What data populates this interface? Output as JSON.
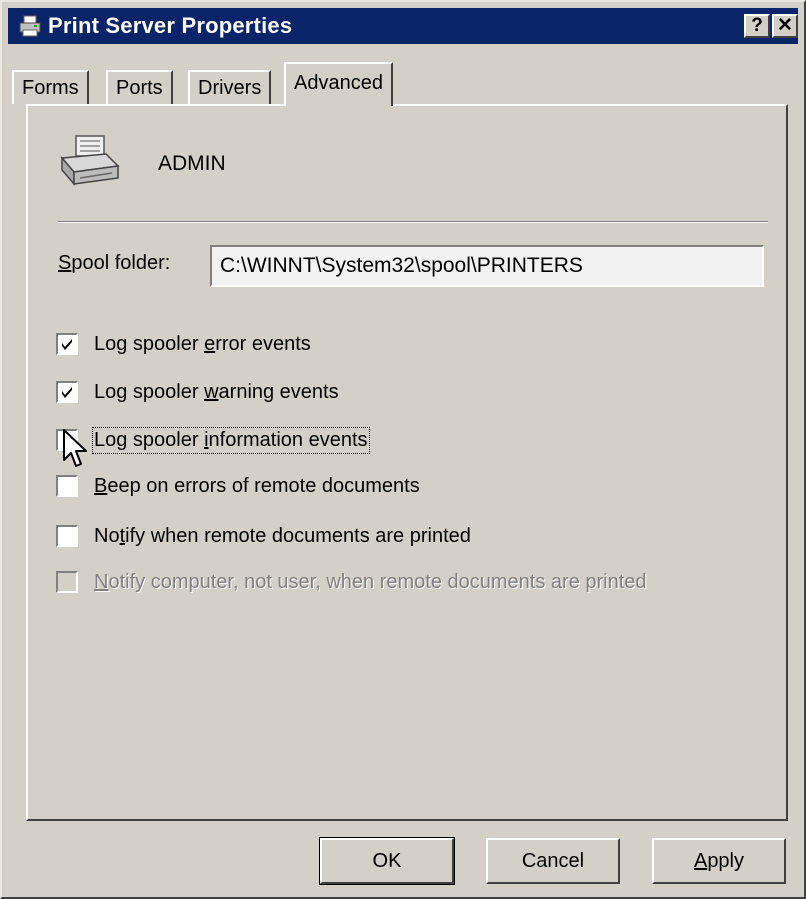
{
  "window": {
    "title": "Print Server Properties",
    "help_label": "?",
    "close_label": "✕",
    "title_icon": "printer-icon"
  },
  "tabs": [
    {
      "label": "Forms",
      "active": false
    },
    {
      "label": "Ports",
      "active": false
    },
    {
      "label": "Drivers",
      "active": false
    },
    {
      "label": "Advanced",
      "active": true
    }
  ],
  "server": {
    "icon": "print-server-icon",
    "name": "ADMIN"
  },
  "spool": {
    "label_accel": "S",
    "label_rest": "pool folder:",
    "value": "C:\\WINNT\\System32\\spool\\PRINTERS"
  },
  "options": [
    {
      "pre": "Log spooler ",
      "accel": "e",
      "post": "rror events",
      "checked": true,
      "enabled": true,
      "focused": false
    },
    {
      "pre": "Log spooler ",
      "accel": "w",
      "post": "arning events",
      "checked": true,
      "enabled": true,
      "focused": false
    },
    {
      "pre": "Log spooler ",
      "accel": "i",
      "post": "nformation events",
      "checked": false,
      "enabled": true,
      "focused": true
    },
    {
      "pre": "",
      "accel": "B",
      "post": "eep on errors of remote documents",
      "checked": false,
      "enabled": true,
      "focused": false
    },
    {
      "pre": "No",
      "accel": "t",
      "post": "ify when remote documents are printed",
      "checked": false,
      "enabled": true,
      "focused": false
    },
    {
      "pre": "",
      "accel": "N",
      "post": "otify computer, not user, when remote documents are printed",
      "checked": false,
      "enabled": false,
      "focused": false
    }
  ],
  "buttons": {
    "ok": "OK",
    "cancel": "Cancel",
    "apply_accel": "A",
    "apply_rest": "pply"
  },
  "colors": {
    "titlebar": "#0a246a",
    "face": "#d4d0c8"
  }
}
